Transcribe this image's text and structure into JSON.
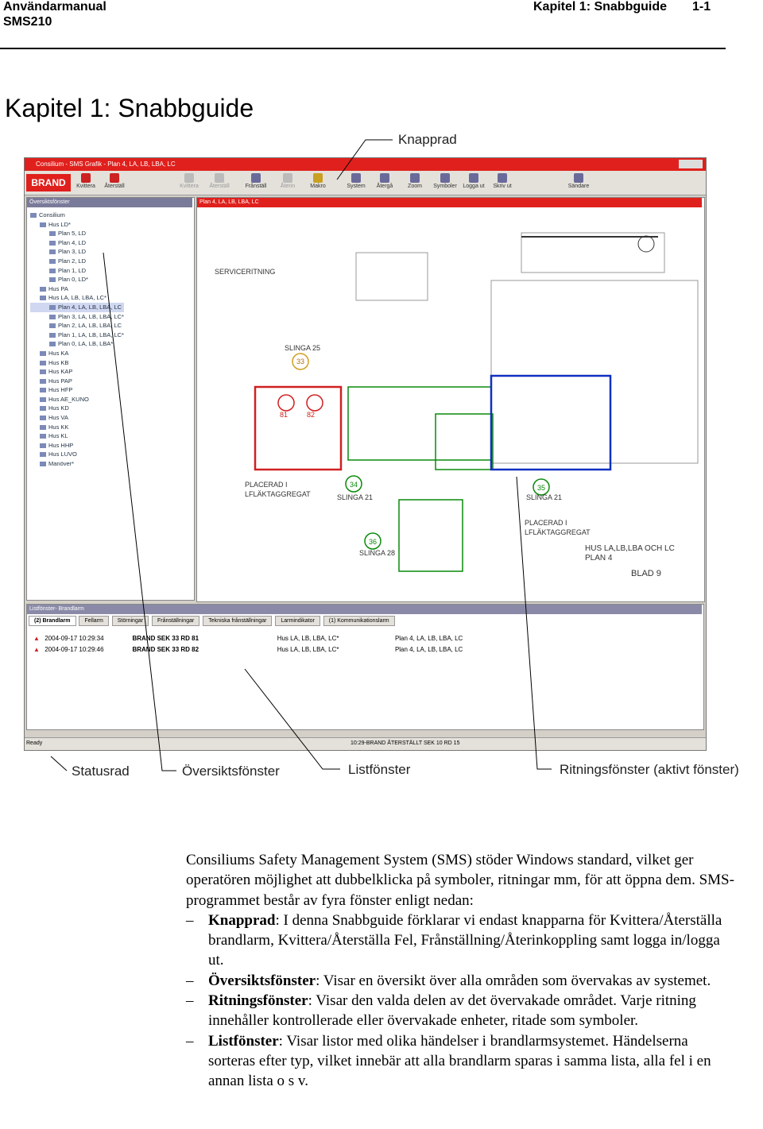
{
  "header": {
    "manual": "Användarmanual",
    "model": "SMS210",
    "chapter_ref": "Kapitel 1: Snabbguide",
    "page": "1-1"
  },
  "chapter_title": "Kapitel 1: Snabbguide",
  "callouts": {
    "knapprad": "Knapprad",
    "statusrad": "Statusrad",
    "oversikt": "Översiktsfönster",
    "list": "Listfönster",
    "ritning": "Ritningsfönster (aktivt fönster)"
  },
  "screenshot": {
    "title": "Consilium - SMS Grafik - Plan 4, LA, LB, LBA, LC",
    "brand": "BRAND",
    "toolbar": [
      "Kvittera",
      "Återställ",
      "Kvittera",
      "Återställ",
      "Frånställ",
      "Återin",
      "Makro",
      "System",
      "Återgå",
      "Zoom",
      "Symboler",
      "Logga ut",
      "Skriv ut",
      "Sändare"
    ],
    "overview_title": "Översiktsfönster",
    "tree": [
      "Consilium",
      "Hus LD*",
      "Plan 5, LD",
      "Plan 4, LD",
      "Plan 3, LD",
      "Plan 2, LD",
      "Plan 1, LD",
      "Plan 0, LD*",
      "Hus PA",
      "Hus LA, LB, LBA, LC*",
      "Plan 4, LA, LB, LBA, LC",
      "Plan 3, LA, LB, LBA, LC*",
      "Plan 2, LA, LB, LBA, LC",
      "Plan 1, LA, LB, LBA, LC*",
      "Plan 0, LA, LB, LBA*",
      "Hus KA",
      "Hus KB",
      "Hus KAP",
      "Hus PAP",
      "Hus HFP",
      "Hus AE_KUNO",
      "Hus KD",
      "Hus VA",
      "Hus KK",
      "Hus KL",
      "Hus HHP",
      "Hus LUVO",
      "Manöver*"
    ],
    "drawing_title": "Plan 4, LA, LB, LBA, LC",
    "drawing_labels": [
      "SERVICERITNING",
      "SLINGA 25",
      "33",
      "81",
      "82",
      "PLACERAD I",
      "LFLÄKTAGGREGAT",
      "34",
      "SLINGA 21",
      "35",
      "SLINGA 21",
      "36",
      "SLINGA 28",
      "PLACERAD I",
      "LFLÄKTAGGREGAT",
      "HUS LA,LB,LBA OCH LC",
      "PLAN 4",
      "BLAD 9"
    ],
    "list_title": "Listfönster- Brandlarm",
    "tabs": [
      "(2) Brandlarm",
      "Fellarm",
      "Störningar",
      "Frånställningar",
      "Tekniska frånställningar",
      "Larmindikator",
      "(1) Kommunikationslarm"
    ],
    "rows": [
      {
        "time": "2004-09-17 10:29:34",
        "text": "BRAND SEK 33 RD 81",
        "house": "Hus LA, LB, LBA, LC*",
        "plan": "Plan 4, LA, LB, LBA, LC"
      },
      {
        "time": "2004-09-17 10:29:46",
        "text": "BRAND SEK 33 RD 82",
        "house": "Hus LA, LB, LBA, LC*",
        "plan": "Plan 4, LA, LB, LBA, LC"
      }
    ],
    "status_left": "Ready",
    "status_msg": "10:29-BRAND ÅTERSTÄLLT SEK 10 RD 15"
  },
  "body": {
    "intro": "Consiliums Safety Management System (SMS) stöder Windows standard, vilket ger operatören möjlighet att dubbelklicka på symboler, ritningar mm, för att öppna dem. SMS-programmet består av fyra fönster enligt nedan:",
    "items": [
      {
        "term": "Knapprad",
        "text": ": I denna Snabbguide förklarar vi endast knapparna för Kvittera/Återställa brandlarm, Kvittera/Återställa Fel, Frånställning/Återinkoppling samt logga in/logga ut."
      },
      {
        "term": "Översiktsfönster",
        "text": ": Visar en översikt över alla områden som övervakas av systemet."
      },
      {
        "term": "Ritningsfönster",
        "text": ": Visar den valda delen av det övervakade området. Varje ritning innehåller kontrollerade eller övervakade enheter, ritade som symboler."
      },
      {
        "term": "Listfönster",
        "text": ": Visar listor med olika händelser i brandlarmsystemet. Händelserna sorteras efter typ, vilket innebär att alla brandlarm sparas i samma lista, alla fel i en annan lista o s v."
      }
    ],
    "dash": "–"
  }
}
